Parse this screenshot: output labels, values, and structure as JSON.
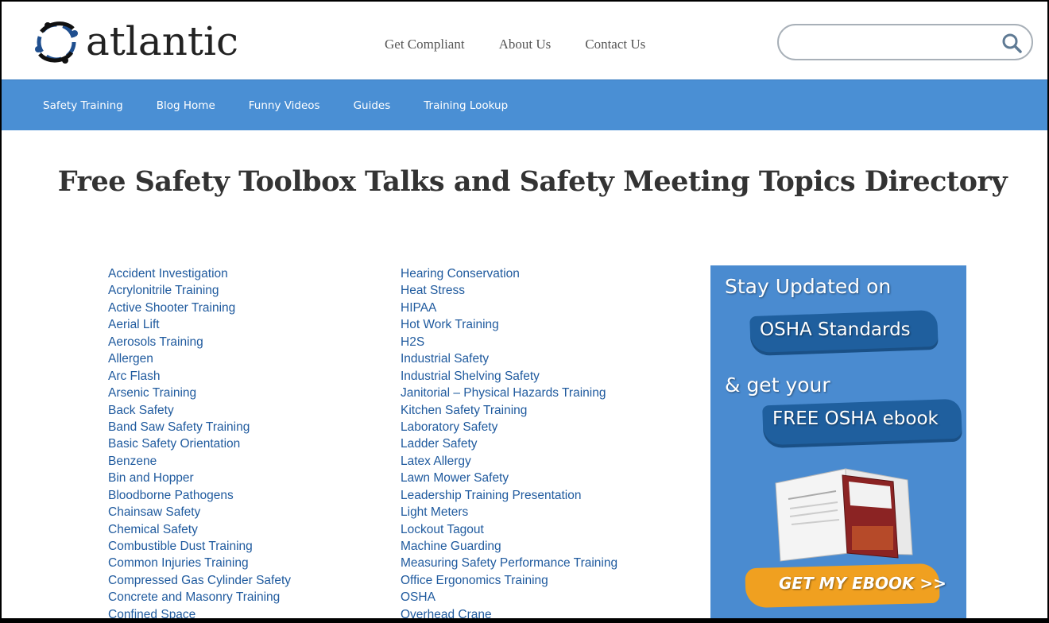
{
  "header": {
    "logo_text": "atlantic",
    "nav": [
      "Get Compliant",
      "About Us",
      "Contact Us"
    ],
    "search": {
      "value": "",
      "placeholder": ""
    }
  },
  "main_nav": [
    "Safety Training",
    "Blog Home",
    "Funny Videos",
    "Guides",
    "Training Lookup"
  ],
  "page_title": "Free Safety Toolbox Talks and Safety Meeting Topics Directory",
  "topics": {
    "col1": [
      "Accident Investigation",
      "Acrylonitrile Training",
      "Active Shooter Training",
      "Aerial Lift",
      "Aerosols Training",
      "Allergen",
      "Arc Flash",
      "Arsenic Training",
      "Back Safety",
      "Band Saw Safety Training",
      "Basic Safety Orientation",
      "Benzene",
      "Bin and Hopper",
      "Bloodborne Pathogens",
      "Chainsaw Safety",
      "Chemical Safety",
      "Combustible Dust Training",
      "Common Injuries Training",
      "Compressed Gas Cylinder Safety",
      "Concrete and Masonry Training",
      "Confined Space"
    ],
    "col2": [
      "Hearing Conservation",
      "Heat Stress",
      "HIPAA",
      "Hot Work Training",
      "H2S",
      "Industrial Safety",
      "Industrial Shelving Safety",
      "Janitorial – Physical Hazards Training",
      "Kitchen Safety Training",
      "Laboratory Safety",
      "Ladder Safety",
      "Latex Allergy",
      "Lawn Mower Safety",
      "Leadership Training Presentation",
      "Light Meters",
      "Lockout Tagout",
      "Machine Guarding",
      "Measuring Safety Performance Training",
      "Office Ergonomics Training",
      "OSHA",
      "Overhead Crane"
    ]
  },
  "banner": {
    "line1": "Stay Updated on",
    "highlight1": "OSHA Standards",
    "line2": "& get your",
    "highlight2": "FREE OSHA ebook",
    "cta": "GET MY EBOOK >>"
  },
  "colors": {
    "nav_bar": "#4a8fd4",
    "link": "#1f5a9e",
    "banner_bg": "#4a8bd0",
    "cta": "#f0a020"
  }
}
